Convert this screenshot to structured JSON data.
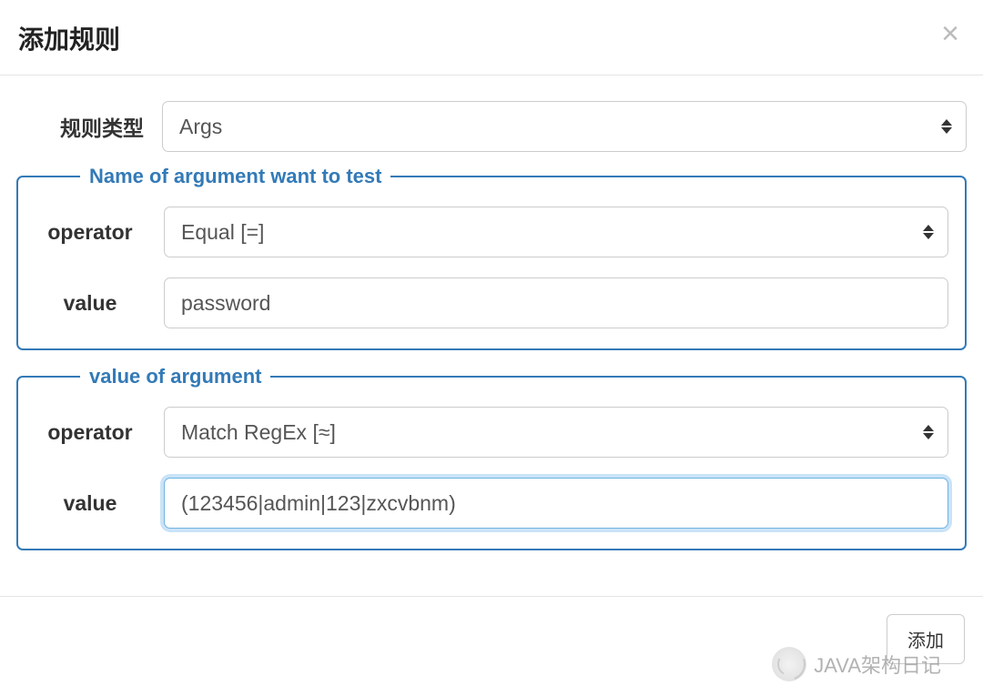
{
  "modal": {
    "title": "添加规则",
    "close_label": "×"
  },
  "rule_type": {
    "label": "规则类型",
    "value": "Args"
  },
  "group_name": {
    "legend": "Name of argument want to test",
    "operator_label": "operator",
    "operator_value": "Equal [=]",
    "value_label": "value",
    "value_value": "password"
  },
  "group_value": {
    "legend": "value of argument",
    "operator_label": "operator",
    "operator_value": "Match RegEx [≈]",
    "value_label": "value",
    "value_value": "(123456|admin|123|zxcvbnm)"
  },
  "footer": {
    "button_label": "添加"
  },
  "watermark": {
    "text": "JAVA架构日记"
  }
}
